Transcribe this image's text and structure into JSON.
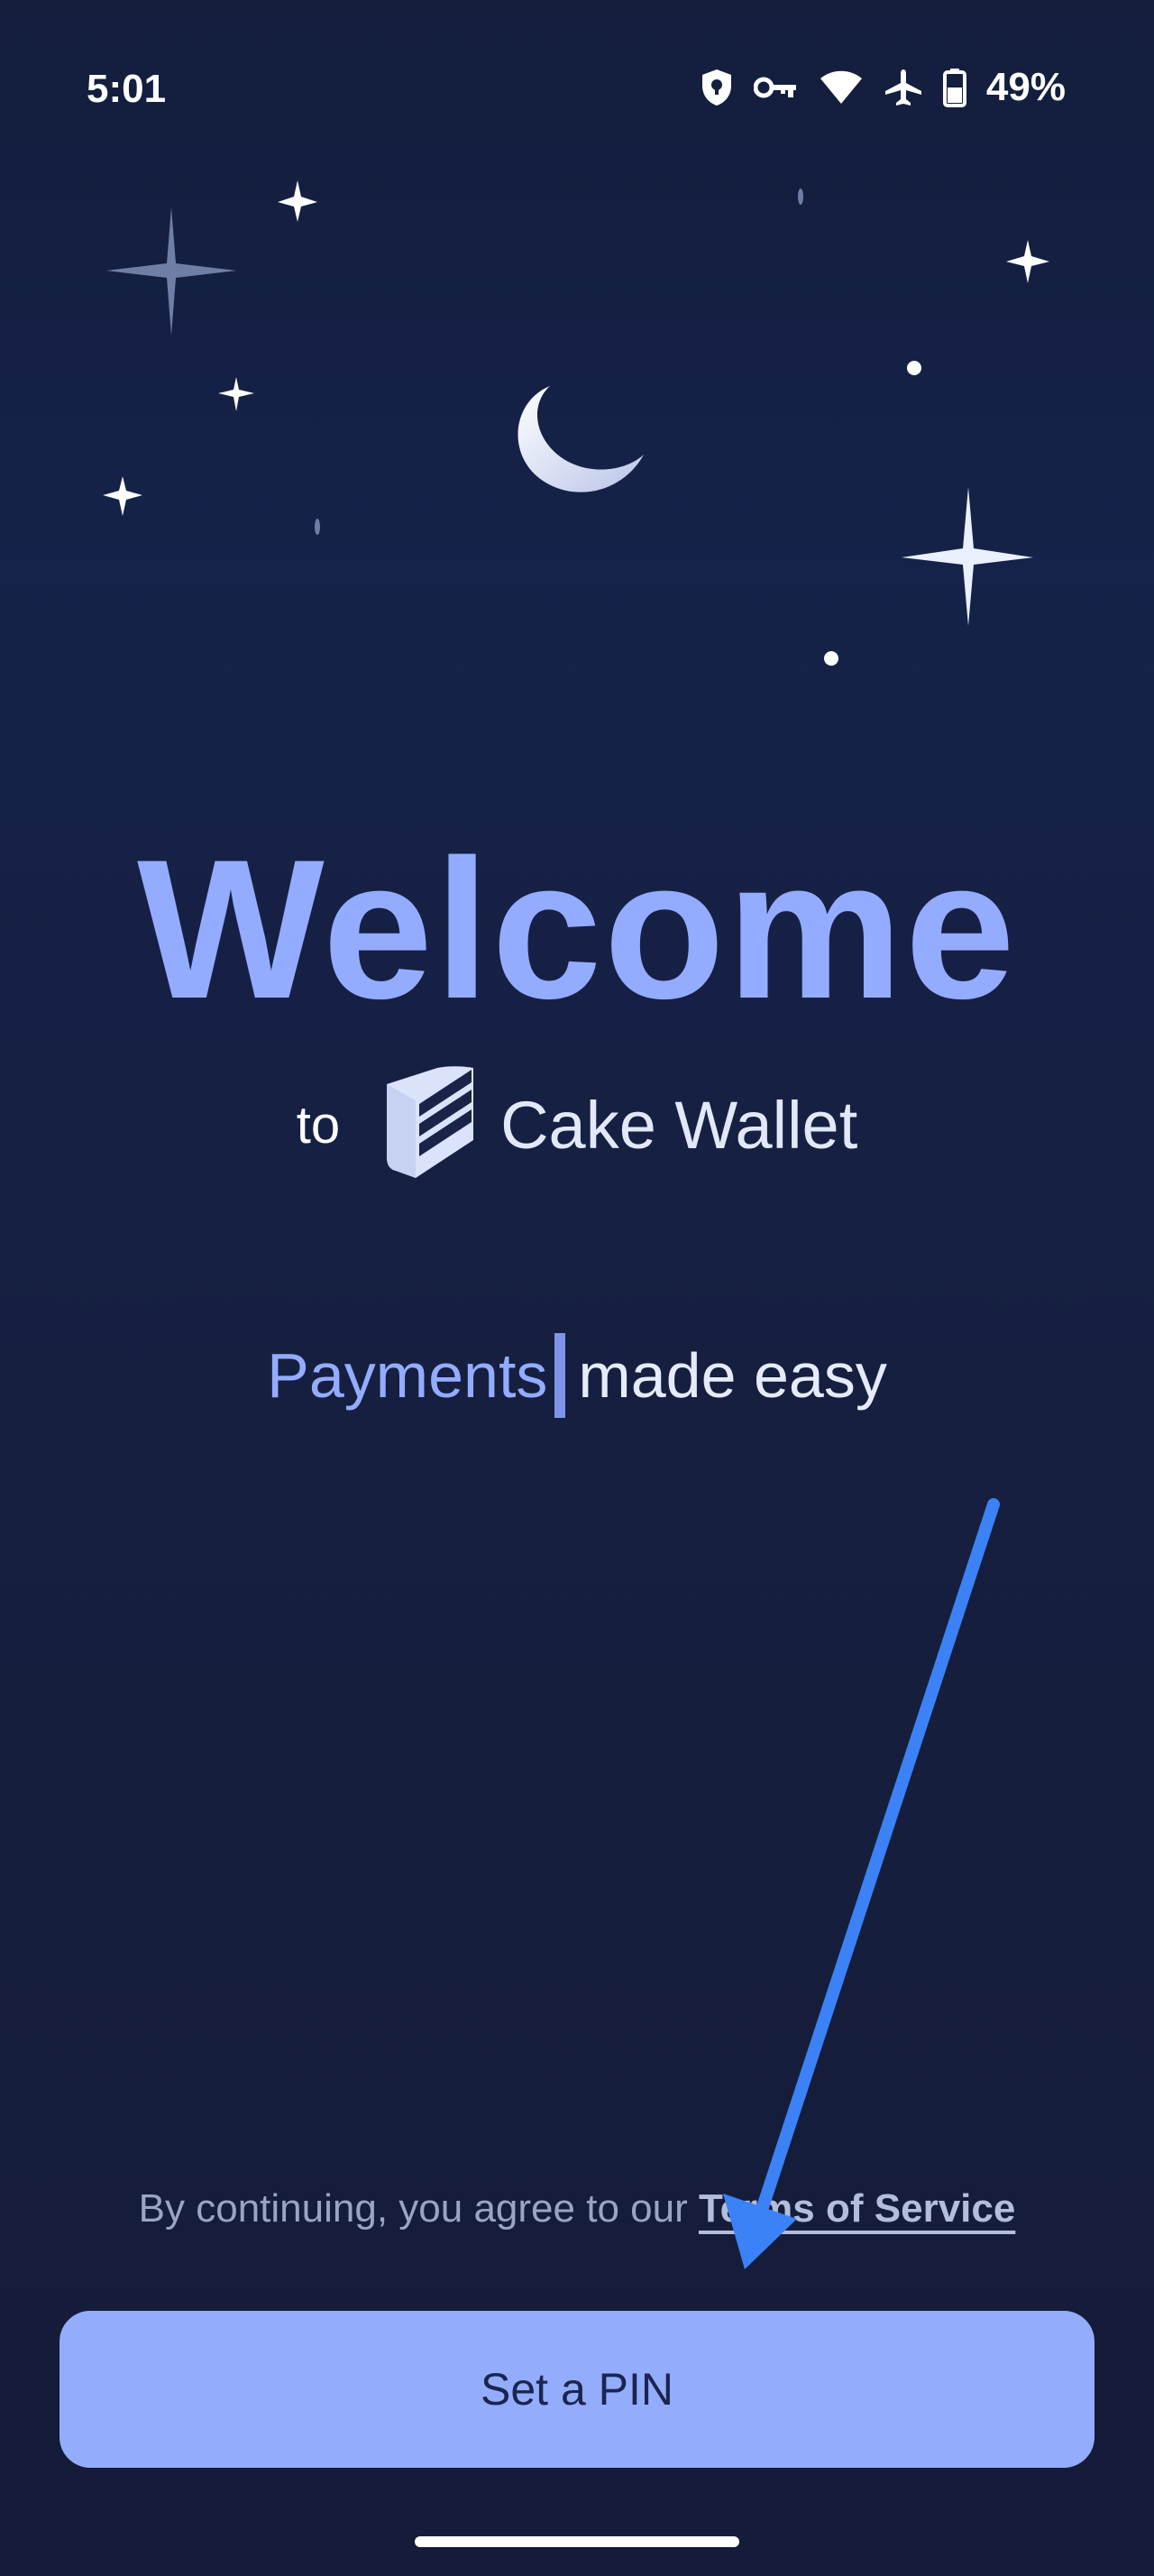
{
  "status_bar": {
    "time": "5:01",
    "battery_percent": "49%",
    "icons": [
      "vpn-shield-icon",
      "key-icon",
      "wifi-icon",
      "airplane-icon",
      "battery-icon"
    ]
  },
  "welcome": {
    "title": "Welcome",
    "to_text": "to",
    "brand_name": "Cake Wallet",
    "logo_icon": "cake-wallet-logo-icon",
    "tagline_highlight": "Payments",
    "tagline_rest": "made easy"
  },
  "footer": {
    "terms_prefix": "By continuing, you agree to our",
    "terms_link": "Terms of Service",
    "set_pin_label": "Set a PIN"
  },
  "colors": {
    "accent": "#93acff",
    "button_bg": "#93adfc",
    "arrow": "#3b82f6",
    "background": "#162146"
  }
}
